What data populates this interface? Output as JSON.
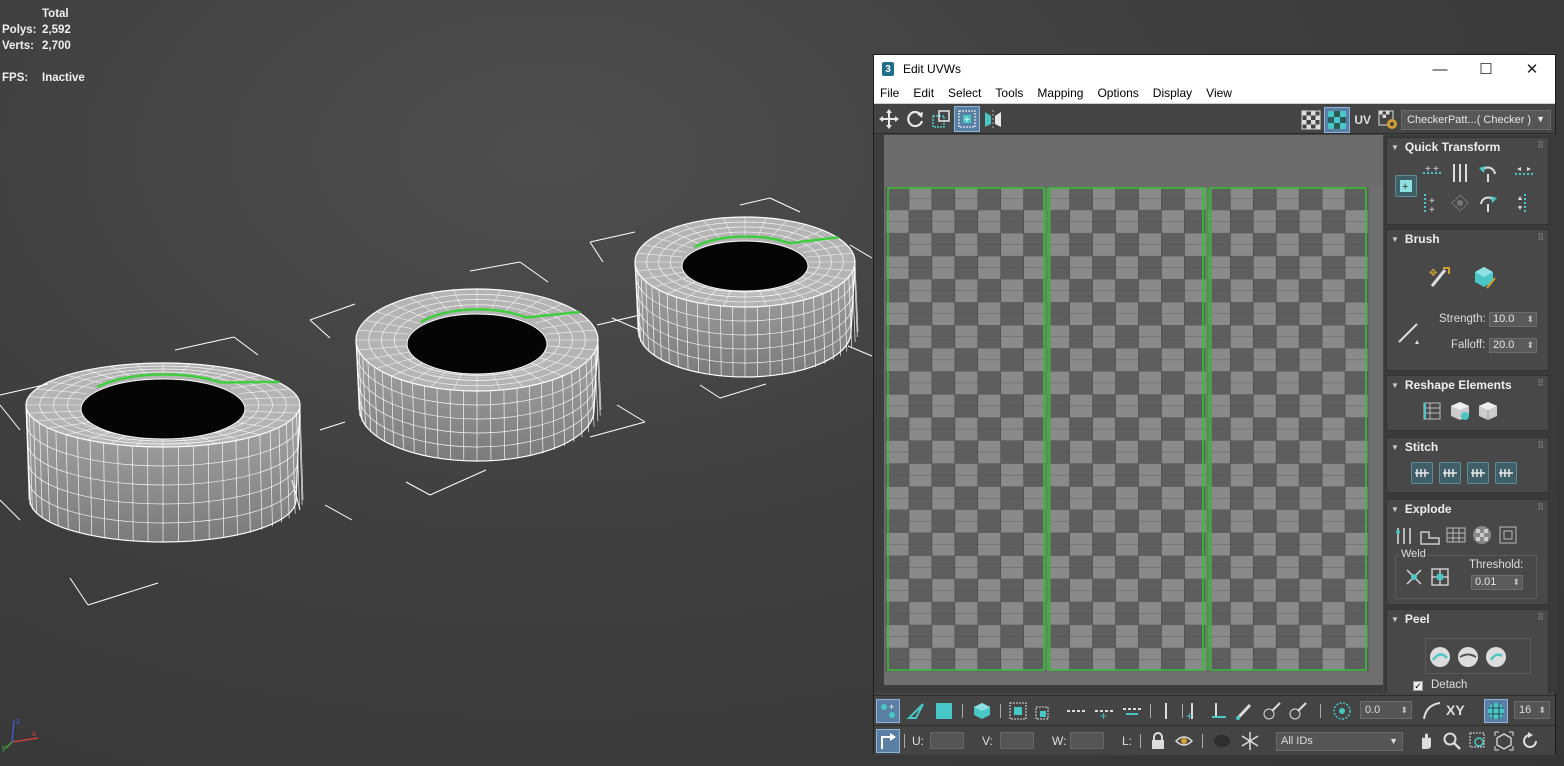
{
  "viewport": {
    "stats": {
      "total_header": "Total",
      "polys_label": "Polys:",
      "polys_value": "2,592",
      "verts_label": "Verts:",
      "verts_value": "2,700",
      "fps_label": "FPS:",
      "fps_value": "Inactive"
    },
    "axis_labels": {
      "x": "x",
      "y": "y",
      "z": "z"
    },
    "selection_edge_color": "#3ecf3e",
    "wire_color": "#ffffff"
  },
  "uvw_window": {
    "title": "Edit UVWs",
    "app_icon_glyph": "3",
    "window_buttons": {
      "minimize": "—",
      "maximize": "☐",
      "close": "✕"
    },
    "menu": [
      "File",
      "Edit",
      "Select",
      "Tools",
      "Mapping",
      "Options",
      "Display",
      "View"
    ],
    "toolbar": {
      "uv_label": "UV",
      "map_select": "CheckerPatt...( Checker )",
      "icons": [
        "move-icon",
        "rotate-icon",
        "scale-icon",
        "freeform-icon",
        "mirror-icon"
      ]
    },
    "uv_editor": {
      "checker_light": "#8a8a8a",
      "checker_dark": "#5e5e5e",
      "shell_outline_color": "#35c435"
    },
    "rollouts": {
      "quick_transform": {
        "title": "Quick Transform"
      },
      "brush": {
        "title": "Brush",
        "strength_label": "Strength:",
        "strength_value": "10.0",
        "falloff_label": "Falloff:",
        "falloff_value": "20.0"
      },
      "reshape": {
        "title": "Reshape Elements"
      },
      "stitch": {
        "title": "Stitch"
      },
      "explode": {
        "title": "Explode",
        "weld_label": "Weld",
        "threshold_label": "Threshold:",
        "threshold_value": "0.01"
      },
      "peel": {
        "title": "Peel",
        "detach_label": "Detach",
        "detach_checked": "✓"
      }
    },
    "bottom_bar": {
      "rotation_value": "0.0",
      "xy_label": "XY",
      "grid_value": "16",
      "u_label": "U:",
      "v_label": "V:",
      "w_label": "W:",
      "l_label": "L:",
      "id_select": "All IDs"
    },
    "accent_color": "#49c6c6"
  }
}
